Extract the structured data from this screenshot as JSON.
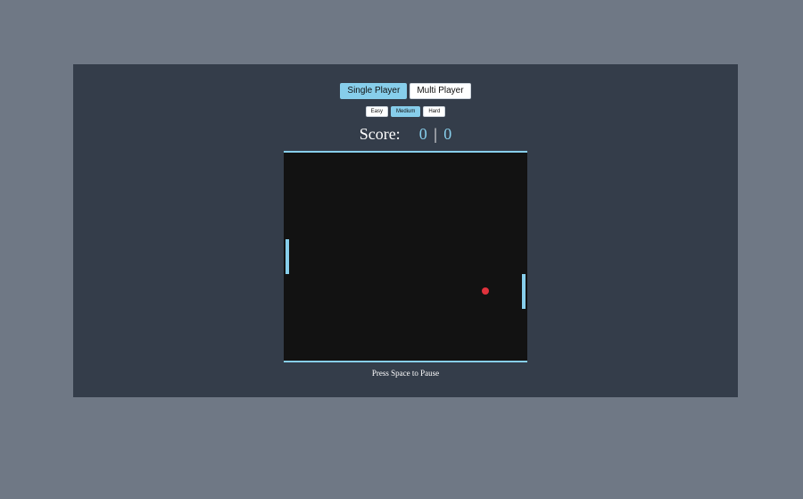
{
  "modes": {
    "single_label": "Single Player",
    "multi_label": "Multi Player",
    "selected": "Single Player"
  },
  "difficulty": {
    "easy_label": "Easy",
    "medium_label": "Medium",
    "hard_label": "Hard",
    "selected": "Medium"
  },
  "score": {
    "label": "Score:",
    "left": "0",
    "separator": "|",
    "right": "0"
  },
  "hint": "Press Space to Pause",
  "colors": {
    "page_background": "#6f7885",
    "panel_background": "#343d4a",
    "accent": "#87ceeb",
    "board": "#121212",
    "ball": "#e0323c"
  }
}
